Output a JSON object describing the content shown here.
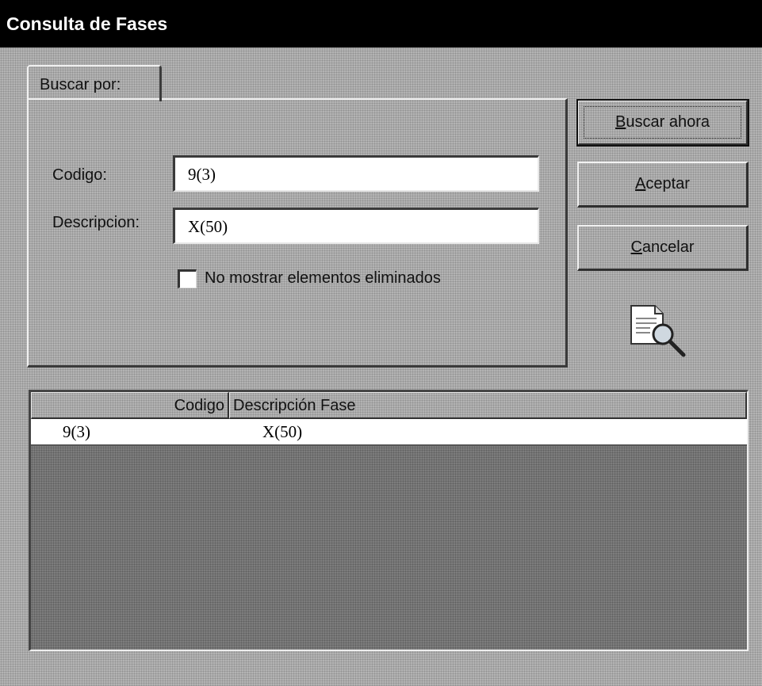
{
  "window": {
    "title": "Consulta de Fases"
  },
  "tabs": [
    {
      "label": "Buscar por:"
    }
  ],
  "form": {
    "codigo_label": "Codigo:",
    "codigo_value": "9(3)",
    "descripcion_label": "Descripcion:",
    "descripcion_value": "X(50)",
    "checkbox_label": "No mostrar elementos eliminados",
    "checkbox_checked": false
  },
  "buttons": {
    "buscar": {
      "mnemonic": "B",
      "rest": "uscar ahora"
    },
    "aceptar": {
      "mnemonic": "A",
      "rest": "ceptar"
    },
    "cancelar": {
      "mnemonic": "C",
      "rest": "ancelar"
    }
  },
  "grid": {
    "columns": [
      "Codigo",
      "Descripción Fase"
    ],
    "rows": [
      [
        "9(3)",
        "X(50)"
      ]
    ]
  },
  "icons": {
    "search_document": "document-magnifier-icon"
  }
}
